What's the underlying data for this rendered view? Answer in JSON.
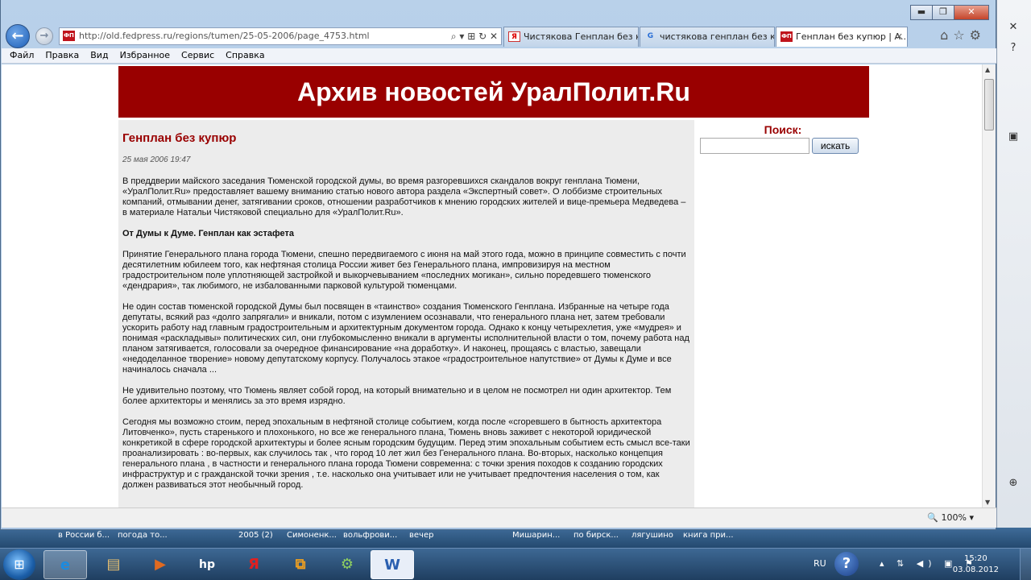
{
  "window": {
    "minimize": "▬",
    "maximize": "❐",
    "close": "✕"
  },
  "nav": {
    "address_url": "http://old.fedpress.ru/regions/tumen/25-05-2006/page_4753.html",
    "address_favicon": "ФП",
    "address_tools": "⌕ ▾ ⊞ ↻ ✕",
    "back_label": "←",
    "forward_label": "→",
    "right_icons": "⌂☆⚙"
  },
  "tabs": [
    {
      "icon": "Я",
      "label": "Чистякова Генплан без к...",
      "active": false
    },
    {
      "icon": "G",
      "label": "чистякова генплан без ку...",
      "active": false
    },
    {
      "icon": "ФП",
      "label": "Генплан без купюр | А...",
      "active": true,
      "close": "✕"
    }
  ],
  "menu": [
    "Файл",
    "Правка",
    "Вид",
    "Избранное",
    "Сервис",
    "Справка"
  ],
  "page": {
    "banner": "Архив новостей УралПолит.Ru",
    "search_label": "Поиск:",
    "search_value": "",
    "search_button": "искать",
    "article": {
      "title": "Генплан без купюр",
      "date": "25 мая 2006 19:47",
      "intro": "В преддверии майского заседания Тюменской городской думы, во время разгоревшихся скандалов вокруг генплана Тюмени, «УралПолит.Ru» предоставляет вашему вниманию статью нового автора раздела «Экспертный совет». О лоббизме строительных компаний, отмывании денег, затягивании сроков, отношении разработчиков к мнению городских жителей и вице-премьера Медведева – в материале Натальи Чистяковой специально для «УралПолит.Ru».",
      "subhead": "От Думы к Думе. Генплан как эстафета",
      "p1": "Принятие Генерального плана города Тюмени, спешно передвигаемого с июня на май этого года, можно в принципе совместить с почти десятилетним юбилеем того, как нефтяная столица России живет без Генерального плана, импровизируя на местном градостроительном поле уплотняющей застройкой и выкорчевыванием «последних могикан», сильно поредевшего тюменского «дендрария», так любимого, не избалованными парковой культурой тюменцами.",
      "p2": "Не один состав тюменской городской Думы был посвящен в «таинство» создания Тюменского Генплана. Избранные на четыре года депутаты, всякий раз «долго запрягали» и вникали, потом с изумлением осознавали, что генерального плана нет, затем требовали ускорить работу над главным градостроительным и архитектурным документом города. Однако к концу четырехлетия, уже «мудрея» и понимая «раскладывы» политических сил, они глубокомысленно вникали в аргументы исполнительной власти о том, почему работа над планом затягивается, голосовали за очередное финансирование «на доработку». И наконец, прощаясь с властью, завещали «недоделанное творение» новому депутатскому корпусу. Получалось этакое «градостроительное напутствие» от Думы к Думе и все начиналось сначала ...",
      "p3": "Не удивительно поэтому, что Тюмень являет собой город, на который внимательно и в целом не посмотрел ни один архитектор. Тем более архитекторы и менялись за это время изрядно.",
      "p4": "Сегодня мы возможно стоим, перед эпохальным в нефтяной столице событием, когда после «сгоревшего в бытность архитектора Литовченко», пусть старенького и плохонького, но все же генерального плана, Тюмень вновь заживет с некоторой юридической конкретикой в сфере городской архитектуры и более ясным городским будущим. Перед этим эпохальным событием есть смысл все-таки проанализировать : во-первых, как случилось так , что город 10 лет жил без Генерального плана. Во-вторых, насколько концепция генерального плана , в частности и генерального плана города Тюмени современна: с точки зрения походов к созданию городских инфраструктур и с гражданской точки зрения , т.е. насколько она учитывает или не учитывает предпочтения населения о том, как должен развиваться этот необычный город."
    }
  },
  "status": {
    "zoom": "100%"
  },
  "bg_strip": [
    "в России б...",
    "погода то...",
    "2005 (2)",
    "Симоненк...",
    "вольфрови...",
    "вечер",
    "Мишарин...",
    "по бирск...",
    "лягушино",
    "книга при..."
  ],
  "taskbar": {
    "apps": [
      "e",
      "▤",
      "▶",
      "hp",
      "Я",
      "⧉",
      "⚙",
      "W"
    ],
    "lang": "RU",
    "help": "?",
    "tray_icons": "▴ ⇅ ◀) ▣ ⚑",
    "time": "15:20",
    "date": "03.08.2012"
  }
}
